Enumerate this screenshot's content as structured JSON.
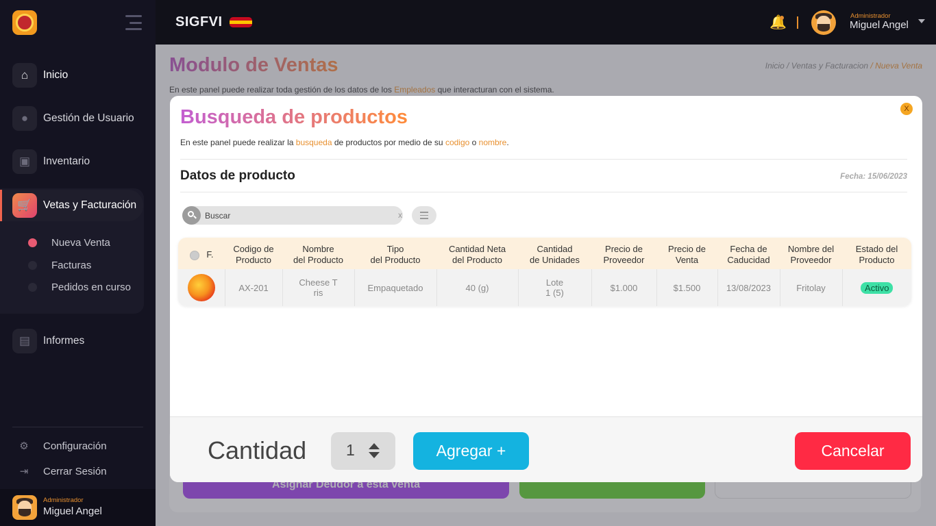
{
  "app": {
    "brand": "SIGFVI",
    "flag_colors": [
      "#c60b1e",
      "#ffc400",
      "#c60b1e"
    ]
  },
  "sidebar": {
    "items": [
      {
        "label": "Inicio",
        "icon": "home-icon"
      },
      {
        "label": "Gestión de Usuario",
        "icon": "user-icon"
      },
      {
        "label": "Inventario",
        "icon": "box-icon"
      },
      {
        "label": "Vetas y Facturación",
        "icon": "cart-icon"
      },
      {
        "label": "Informes",
        "icon": "report-icon"
      }
    ],
    "subitems": [
      {
        "label": "Nueva Venta"
      },
      {
        "label": "Facturas"
      },
      {
        "label": "Pedidos en curso"
      }
    ],
    "bottom": [
      {
        "label": "Configuración",
        "icon": "gear-icon"
      },
      {
        "label": "Cerrar Sesión",
        "icon": "logout-icon"
      }
    ],
    "user": {
      "role": "Administrador",
      "name": "Miguel Angel"
    }
  },
  "topbar": {
    "user": {
      "role": "Administrador",
      "name": "Miguel Angel"
    }
  },
  "page": {
    "title": "Modulo de Ventas",
    "breadcrumb": {
      "home": "Inicio",
      "sep1": " / ",
      "section": "Ventas y Facturacion",
      "sep2": " / ",
      "current": "Nueva Venta"
    },
    "desc_pre": "En este panel puede realizar toda gestión de los datos de los ",
    "desc_hl": "Empleados",
    "desc_post": " que interacturan con el sistema.",
    "bg_button": "Asignar Deudor a esta venta"
  },
  "modal": {
    "close": "X",
    "title": "Busqueda de productos",
    "desc_1": "En este panel puede realizar la ",
    "desc_hl1": "busqueda",
    "desc_2": " de productos por medio de su ",
    "desc_hl2": "codigo",
    "desc_3": " o ",
    "desc_hl3": "nombre",
    "desc_4": ".",
    "subtitle": "Datos de producto",
    "date": "Fecha: 15/06/2023",
    "search": {
      "placeholder": "Buscar",
      "clear": "x"
    },
    "table": {
      "headers": [
        {
          "l1": "F.",
          "l2": ""
        },
        {
          "l1": "Codigo de",
          "l2": "Producto"
        },
        {
          "l1": "Nombre",
          "l2": "del Producto"
        },
        {
          "l1": "Tipo",
          "l2": "del Producto"
        },
        {
          "l1": "Cantidad Neta",
          "l2": "del Producto"
        },
        {
          "l1": "Cantidad",
          "l2": "de Unidades"
        },
        {
          "l1": "Precio de",
          "l2": "Proveedor"
        },
        {
          "l1": "Precio de",
          "l2": "Venta"
        },
        {
          "l1": "Fecha de",
          "l2": "Caducidad"
        },
        {
          "l1": "Nombre del",
          "l2": "Proveedor"
        },
        {
          "l1": "Estado del",
          "l2": "Producto"
        }
      ],
      "rows": [
        {
          "code": "AX-201",
          "name_1": "Cheese T",
          "name_2": "ris",
          "type": "Empaquetado",
          "net": "40 (g)",
          "units_1": "Lote",
          "units_2": "1 (5)",
          "cost": "$1.000",
          "price": "$1.500",
          "expiry": "13/08/2023",
          "supplier": "Fritolay",
          "status": "Activo"
        }
      ]
    },
    "footer": {
      "qty_label": "Cantidad",
      "qty_value": "1",
      "add": "Agregar +",
      "cancel": "Cancelar"
    }
  }
}
